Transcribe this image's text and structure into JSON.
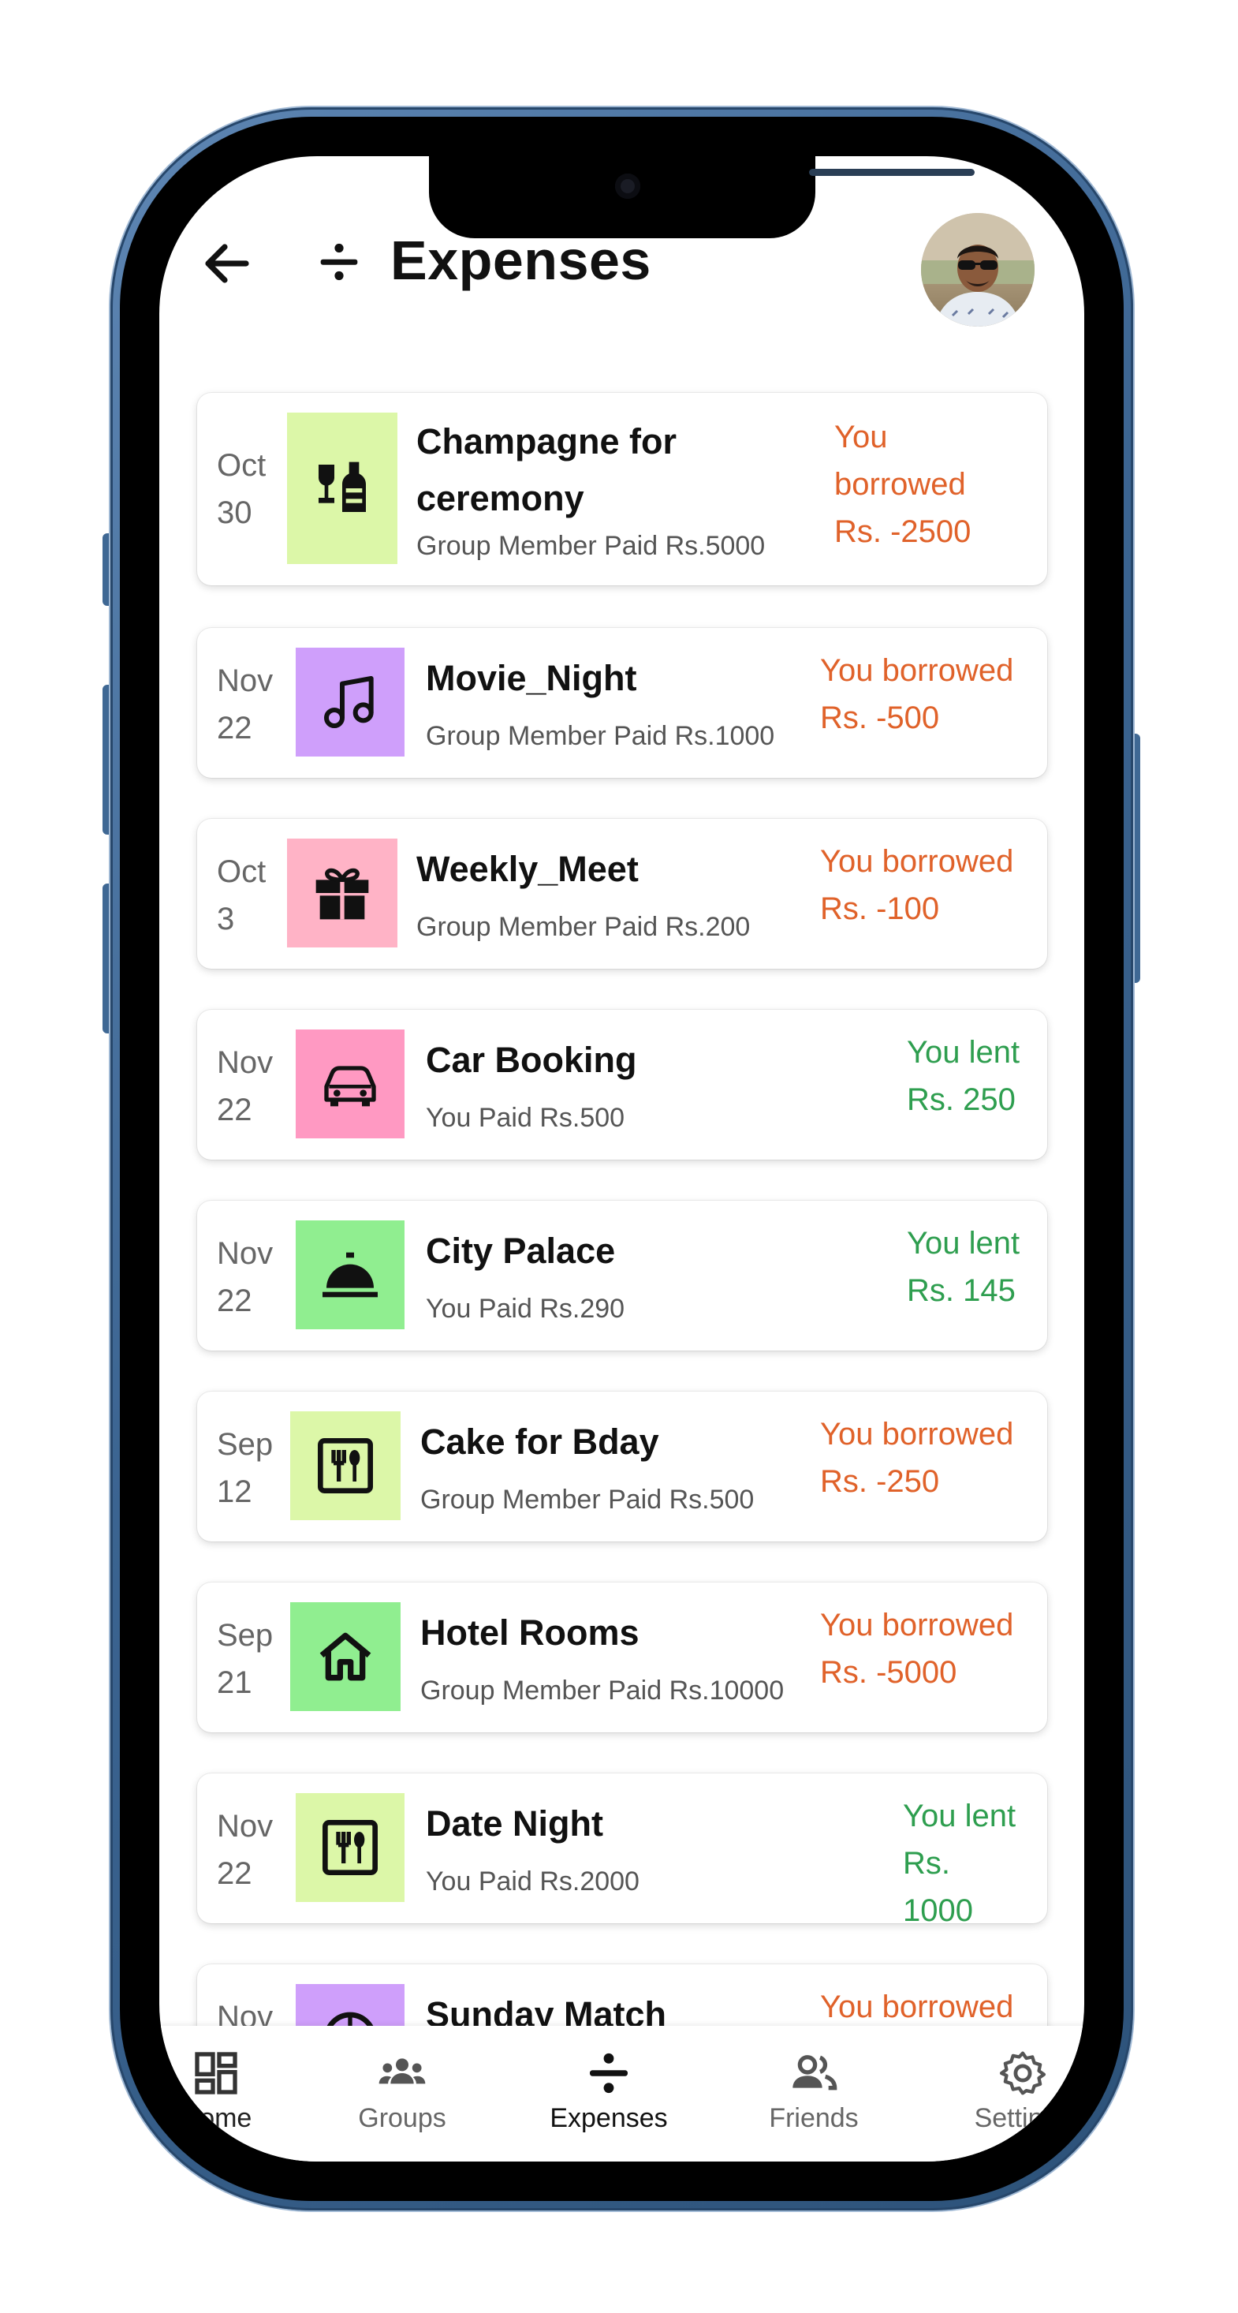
{
  "header": {
    "title": "Expenses",
    "back_icon": "arrow-left-icon",
    "title_icon": "divide-icon",
    "avatar": "user-avatar"
  },
  "colors": {
    "borrowed": "#e0622a",
    "lent": "#2e9e4f",
    "green_tile": "#dcf7a8",
    "purple_tile": "#cf9ffb",
    "pink_tile": "#ffb3c6",
    "lime_tile": "#90ee90",
    "rose_tile": "#ff99c2"
  },
  "expenses": [
    {
      "month": "Oct",
      "day": "30",
      "name_line1": "Champagne for",
      "name_line2": "ceremony",
      "paid": "Group Member Paid Rs.5000",
      "status_line1": "You",
      "status_line2": "borrowed",
      "amount": "Rs. -2500",
      "icon": "wine-bottle-icon",
      "tile": "#dcf7a8"
    },
    {
      "month": "Nov",
      "day": "22",
      "name": "Movie_Night",
      "paid": "Group Member Paid Rs.1000",
      "status": "You borrowed",
      "amount": "Rs. -500",
      "icon": "music-note-icon",
      "tile": "#cf9ffb"
    },
    {
      "month": "Oct",
      "day": "3",
      "name": "Weekly_Meet",
      "paid": "Group Member Paid Rs.200",
      "status": "You borrowed",
      "amount": "Rs. -100",
      "icon": "gift-icon",
      "tile": "#ffb3c6"
    },
    {
      "month": "Nov",
      "day": "22",
      "name": "Car Booking",
      "paid": "You Paid Rs.500",
      "status": "You lent",
      "amount": "Rs. 250",
      "icon": "car-icon",
      "tile": "#ff99c2"
    },
    {
      "month": "Nov",
      "day": "22",
      "name": "City Palace",
      "paid": "You Paid Rs.290",
      "status": "You lent",
      "amount": "Rs. 145",
      "icon": "service-bell-icon",
      "tile": "#90ee90"
    },
    {
      "month": "Sep",
      "day": "12",
      "name": "Cake for Bday",
      "paid": "Group Member Paid Rs.500",
      "status": "You borrowed",
      "amount": "Rs. -250",
      "icon": "restaurant-icon",
      "tile": "#dcf7a8"
    },
    {
      "month": "Sep",
      "day": "21",
      "name": "Hotel Rooms",
      "paid": "Group Member Paid Rs.10000",
      "status": "You borrowed",
      "amount": "Rs. -5000",
      "icon": "home-icon",
      "tile": "#90ee90"
    },
    {
      "month": "Nov",
      "day": "22",
      "name": "Date Night",
      "paid": "You Paid Rs.2000",
      "status": "You lent",
      "amount": "Rs. 1000",
      "icon": "restaurant-icon",
      "tile": "#dcf7a8"
    },
    {
      "month": "Nov",
      "name": "Sunday Match",
      "status": "You borrowed",
      "icon": "sports-ball-icon",
      "tile": "#cf9ffb"
    }
  ],
  "nav": [
    {
      "label": "Home",
      "icon": "dashboard-icon"
    },
    {
      "label": "Groups",
      "icon": "groups-icon"
    },
    {
      "label": "Expenses",
      "icon": "divide-icon",
      "active": true
    },
    {
      "label": "Friends",
      "icon": "friends-icon"
    },
    {
      "label": "Settings",
      "icon": "gear-icon"
    }
  ]
}
